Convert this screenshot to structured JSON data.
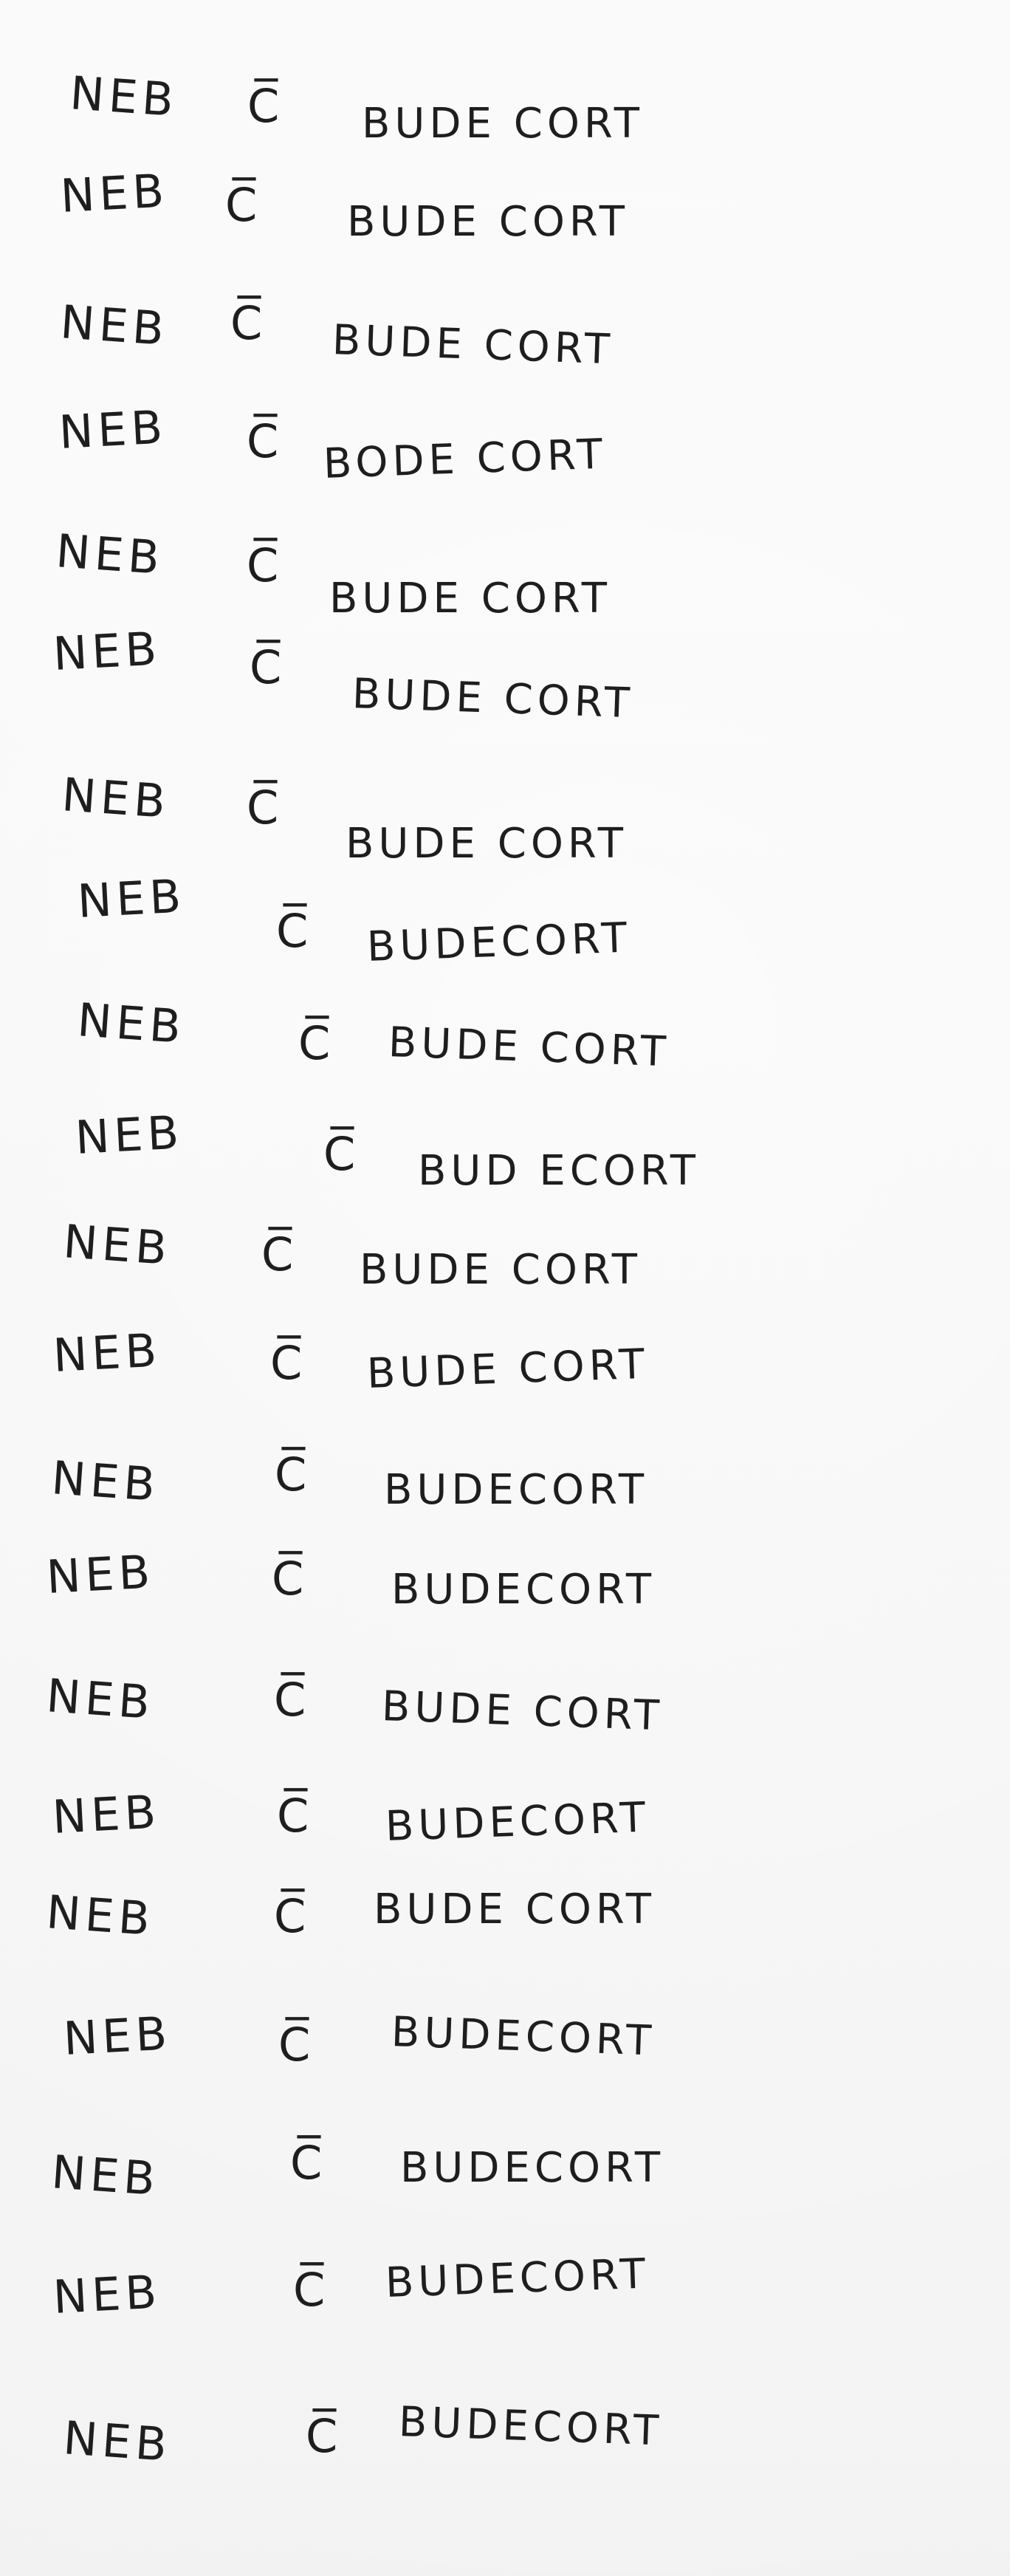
{
  "document": {
    "lines": [
      {
        "left": "NEB",
        "mid": "C̅",
        "right": "BUDE CORT"
      },
      {
        "left": "NEB",
        "mid": "C̅",
        "right": "BUDE CORT"
      },
      {
        "left": "NEB",
        "mid": "C̅",
        "right": "BUDE CORT"
      },
      {
        "left": "NEB",
        "mid": "C̅",
        "right": "BODE CORT"
      },
      {
        "left": "NEB",
        "mid": "C̅",
        "right": "BUDE CORT"
      },
      {
        "left": "NEB",
        "mid": "C̅",
        "right": "BUDE CORT"
      },
      {
        "left": "NEB",
        "mid": "C̅",
        "right": "BUDE CORT"
      },
      {
        "left": "NEB",
        "mid": "C̅",
        "right": "BUDECORT"
      },
      {
        "left": "NEB",
        "mid": "C̅",
        "right": "BUDE CORT"
      },
      {
        "left": "NEB",
        "mid": "C̅",
        "right": "BUD ECORT"
      },
      {
        "left": "NEB",
        "mid": "C̅",
        "right": "BUDE CORT"
      },
      {
        "left": "NEB",
        "mid": "C̅",
        "right": "BUDE CORT"
      },
      {
        "left": "NEB",
        "mid": "C̅",
        "right": "BUDECORT"
      },
      {
        "left": "NEB",
        "mid": "C̅",
        "right": "BUDECORT"
      },
      {
        "left": "NEB",
        "mid": "C̅",
        "right": "BUDE CORT"
      },
      {
        "left": "NEB",
        "mid": "C̅",
        "right": "BUDECORT"
      },
      {
        "left": "NEB",
        "mid": "C̅",
        "right": "BUDE CORT"
      },
      {
        "left": "NEB",
        "mid": "C̅",
        "right": "BUDECORT"
      },
      {
        "left": "NEB",
        "mid": "C̅",
        "right": "BUDECORT"
      },
      {
        "left": "NEB",
        "mid": "C̅",
        "right": "BUDECORT"
      },
      {
        "left": "NEB",
        "mid": "C̅",
        "right": "BUDECORT"
      }
    ]
  }
}
